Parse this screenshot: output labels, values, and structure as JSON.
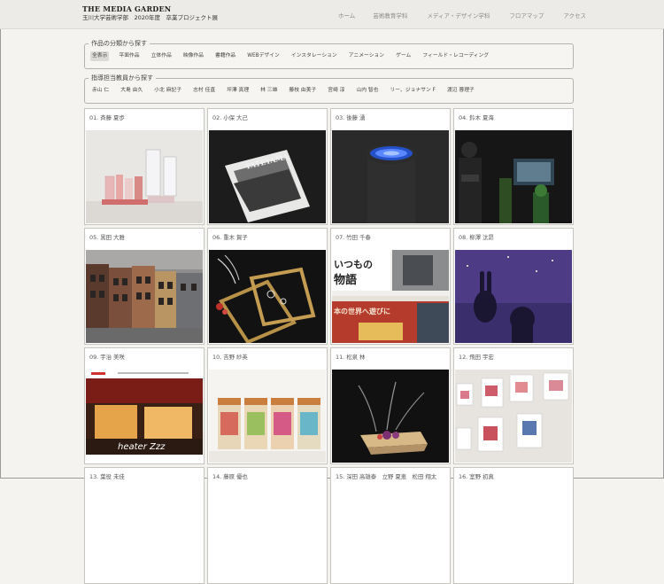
{
  "site": {
    "title": "THE MEDIA GARDEN",
    "subtitle": "玉川大学芸術学部　2020年度　卒業プロジェクト展"
  },
  "nav": [
    "ホーム",
    "芸術教育学科",
    "メディア・デザイン学科",
    "フロアマップ",
    "アクセス"
  ],
  "filters": {
    "category": {
      "legend": "作品の分類から探す",
      "chips": [
        "全表示",
        "平面作品",
        "立体作品",
        "映像作品",
        "書籍作品",
        "WEBデザイン",
        "インスタレーション",
        "アニメーション",
        "ゲーム",
        "フィールド・レコーディング"
      ],
      "active": "全表示"
    },
    "teacher": {
      "legend": "指導担当教員から探す",
      "chips": [
        "赤山 仁",
        "大島 由久",
        "小北 麻記子",
        "志村 佳直",
        "坪澤 真理",
        "林 三雄",
        "藤枝 由美子",
        "宮崎 淳",
        "山内 智也",
        "リー、ジョナサン F",
        "渡辺 蓉理子"
      ]
    }
  },
  "works": [
    {
      "label": "01. 斉藤 夏歩"
    },
    {
      "label": "02. 小保 大己"
    },
    {
      "label": "03. 後藤 湧"
    },
    {
      "label": "04. 鈴木 夏海"
    },
    {
      "label": "05. 黒田 大雅"
    },
    {
      "label": "06. 重木 賀子"
    },
    {
      "label": "07. 竹田 千春"
    },
    {
      "label": "08. 柳澤 汰昂"
    },
    {
      "label": "09. 宇治 美咲"
    },
    {
      "label": "10. 吉野 紗英"
    },
    {
      "label": "11. 松泉 林"
    },
    {
      "label": "12. 飛田 宇宏"
    },
    {
      "label": "13. 葉役 未佳"
    },
    {
      "label": "14. 藤原 優也"
    },
    {
      "label": "15. 深田 高雄泰　立野 夏恵　松田 翔太"
    },
    {
      "label": "16. 室野 初真"
    }
  ],
  "thumb_text": {
    "book": "TATEYAMA",
    "poster_top": "いつもの",
    "poster_mid": "物語",
    "poster_bottom": "本の世界へ遊びに",
    "heater": "heater Zzz"
  }
}
